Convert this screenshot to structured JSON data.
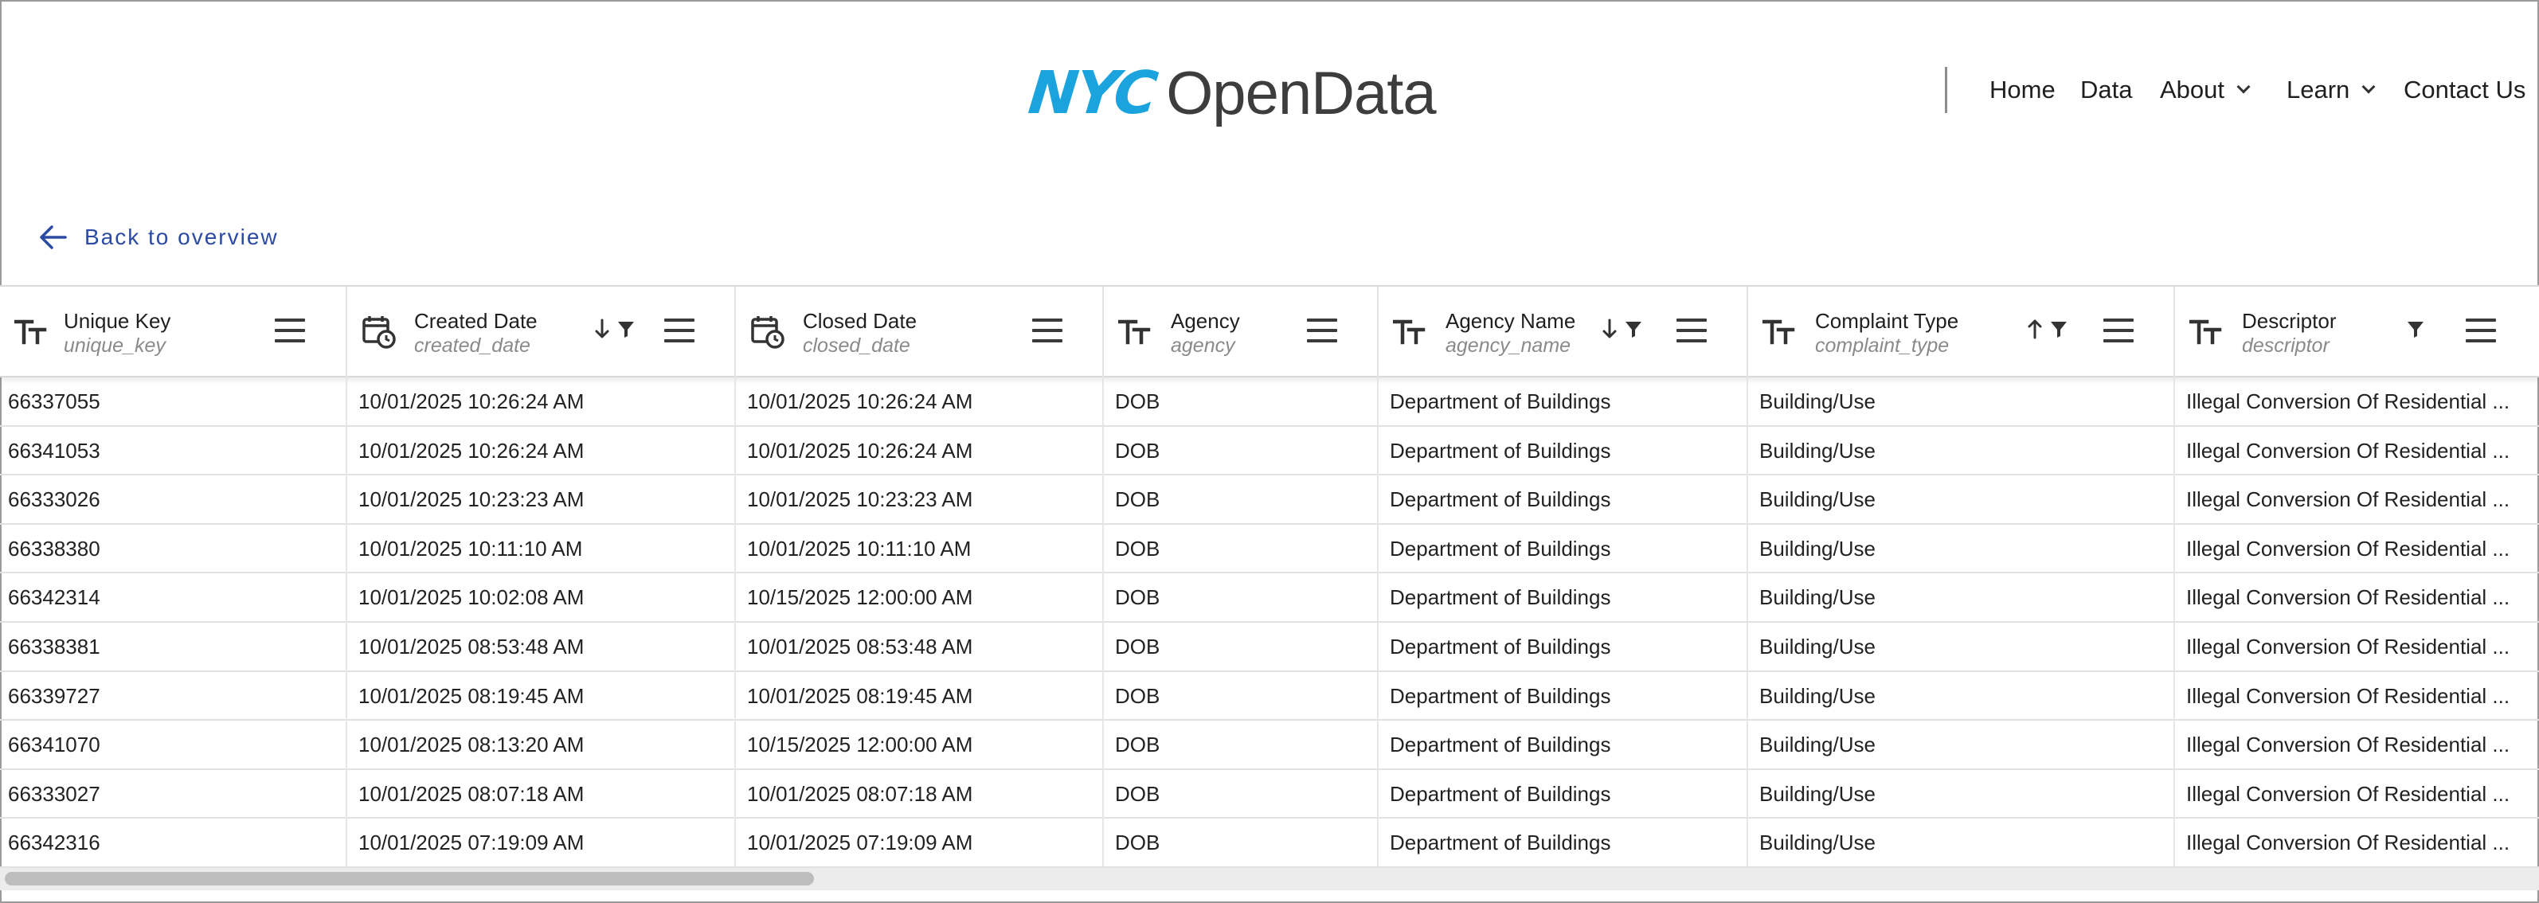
{
  "header": {
    "logo_nyc": "NYC",
    "logo_text": "OpenData",
    "nav": {
      "home": "Home",
      "data": "Data",
      "about": "About",
      "learn": "Learn",
      "contact": "Contact Us"
    }
  },
  "back_link": "Back to overview",
  "table": {
    "columns": [
      {
        "label": "Unique Key",
        "field": "unique_key",
        "type_icon": "text-type-icon",
        "sort": "",
        "filter": false
      },
      {
        "label": "Created Date",
        "field": "created_date",
        "type_icon": "calendar-clock-icon",
        "sort": "descending",
        "filter": true
      },
      {
        "label": "Closed Date",
        "field": "closed_date",
        "type_icon": "calendar-clock-icon",
        "sort": "",
        "filter": false
      },
      {
        "label": "Agency",
        "field": "agency",
        "type_icon": "text-type-icon",
        "sort": "",
        "filter": false
      },
      {
        "label": "Agency Name",
        "field": "agency_name",
        "type_icon": "text-type-icon",
        "sort": "descending",
        "filter": true
      },
      {
        "label": "Complaint Type",
        "field": "complaint_type",
        "type_icon": "text-type-icon",
        "sort": "ascending",
        "filter": true
      },
      {
        "label": "Descriptor",
        "field": "descriptor",
        "type_icon": "text-type-icon",
        "sort": "",
        "filter": true
      }
    ],
    "rows": [
      [
        "66337055",
        "10/01/2025 10:26:24 AM",
        "10/01/2025 10:26:24 AM",
        "DOB",
        "Department of Buildings",
        "Building/Use",
        "Illegal Conversion Of Residential ..."
      ],
      [
        "66341053",
        "10/01/2025 10:26:24 AM",
        "10/01/2025 10:26:24 AM",
        "DOB",
        "Department of Buildings",
        "Building/Use",
        "Illegal Conversion Of Residential ..."
      ],
      [
        "66333026",
        "10/01/2025 10:23:23 AM",
        "10/01/2025 10:23:23 AM",
        "DOB",
        "Department of Buildings",
        "Building/Use",
        "Illegal Conversion Of Residential ..."
      ],
      [
        "66338380",
        "10/01/2025 10:11:10 AM",
        "10/01/2025 10:11:10 AM",
        "DOB",
        "Department of Buildings",
        "Building/Use",
        "Illegal Conversion Of Residential ..."
      ],
      [
        "66342314",
        "10/01/2025 10:02:08 AM",
        "10/15/2025 12:00:00 AM",
        "DOB",
        "Department of Buildings",
        "Building/Use",
        "Illegal Conversion Of Residential ..."
      ],
      [
        "66338381",
        "10/01/2025 08:53:48 AM",
        "10/01/2025 08:53:48 AM",
        "DOB",
        "Department of Buildings",
        "Building/Use",
        "Illegal Conversion Of Residential ..."
      ],
      [
        "66339727",
        "10/01/2025 08:19:45 AM",
        "10/01/2025 08:19:45 AM",
        "DOB",
        "Department of Buildings",
        "Building/Use",
        "Illegal Conversion Of Residential ..."
      ],
      [
        "66341070",
        "10/01/2025 08:13:20 AM",
        "10/15/2025 12:00:00 AM",
        "DOB",
        "Department of Buildings",
        "Building/Use",
        "Illegal Conversion Of Residential ..."
      ],
      [
        "66333027",
        "10/01/2025 08:07:18 AM",
        "10/01/2025 08:07:18 AM",
        "DOB",
        "Department of Buildings",
        "Building/Use",
        "Illegal Conversion Of Residential ..."
      ],
      [
        "66342316",
        "10/01/2025 07:19:09 AM",
        "10/01/2025 07:19:09 AM",
        "DOB",
        "Department of Buildings",
        "Building/Use",
        "Illegal Conversion Of Residential ..."
      ]
    ]
  },
  "colors": {
    "logo_blue": "#1aa3dd",
    "logo_gray": "#3d3d3d",
    "link_blue": "#2b4aa3"
  }
}
